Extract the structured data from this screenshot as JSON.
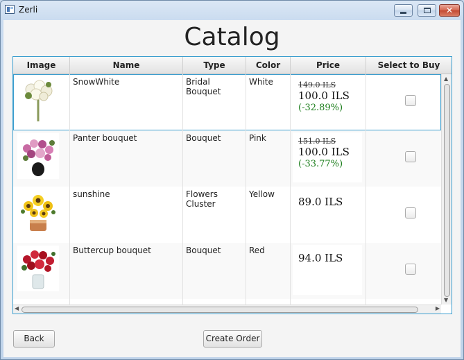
{
  "window": {
    "title": "Zerli"
  },
  "page": {
    "title": "Catalog"
  },
  "table": {
    "columns": [
      "Image",
      "Name",
      "Type",
      "Color",
      "Price",
      "Select to Buy"
    ],
    "rows": [
      {
        "image": "white-bridal-bouquet",
        "name": "SnowWhite",
        "type": "Bridal Bouquet",
        "color": "White",
        "old_price": "149.0 ILS",
        "price": "100.0 ILS",
        "discount": "(-32.89%)",
        "selected": false
      },
      {
        "image": "pink-bouquet-vase",
        "name": "Panter bouquet",
        "type": "Bouquet",
        "color": "Pink",
        "old_price": "151.0 ILS",
        "price": "100.0 ILS",
        "discount": "(-33.77%)",
        "selected": false
      },
      {
        "image": "sunflower-cluster",
        "name": "sunshine",
        "type": "Flowers Cluster",
        "color": "Yellow",
        "old_price": "",
        "price": "89.0 ILS",
        "discount": "",
        "selected": false
      },
      {
        "image": "red-roses-vase",
        "name": "Buttercup bouquet",
        "type": "Bouquet",
        "color": "Red",
        "old_price": "",
        "price": "94.0 ILS",
        "discount": "",
        "selected": false
      }
    ]
  },
  "buttons": {
    "back": "Back",
    "create_order": "Create Order"
  },
  "colors": {
    "accent": "#3b9ecf",
    "discount": "#1a7d1a"
  }
}
